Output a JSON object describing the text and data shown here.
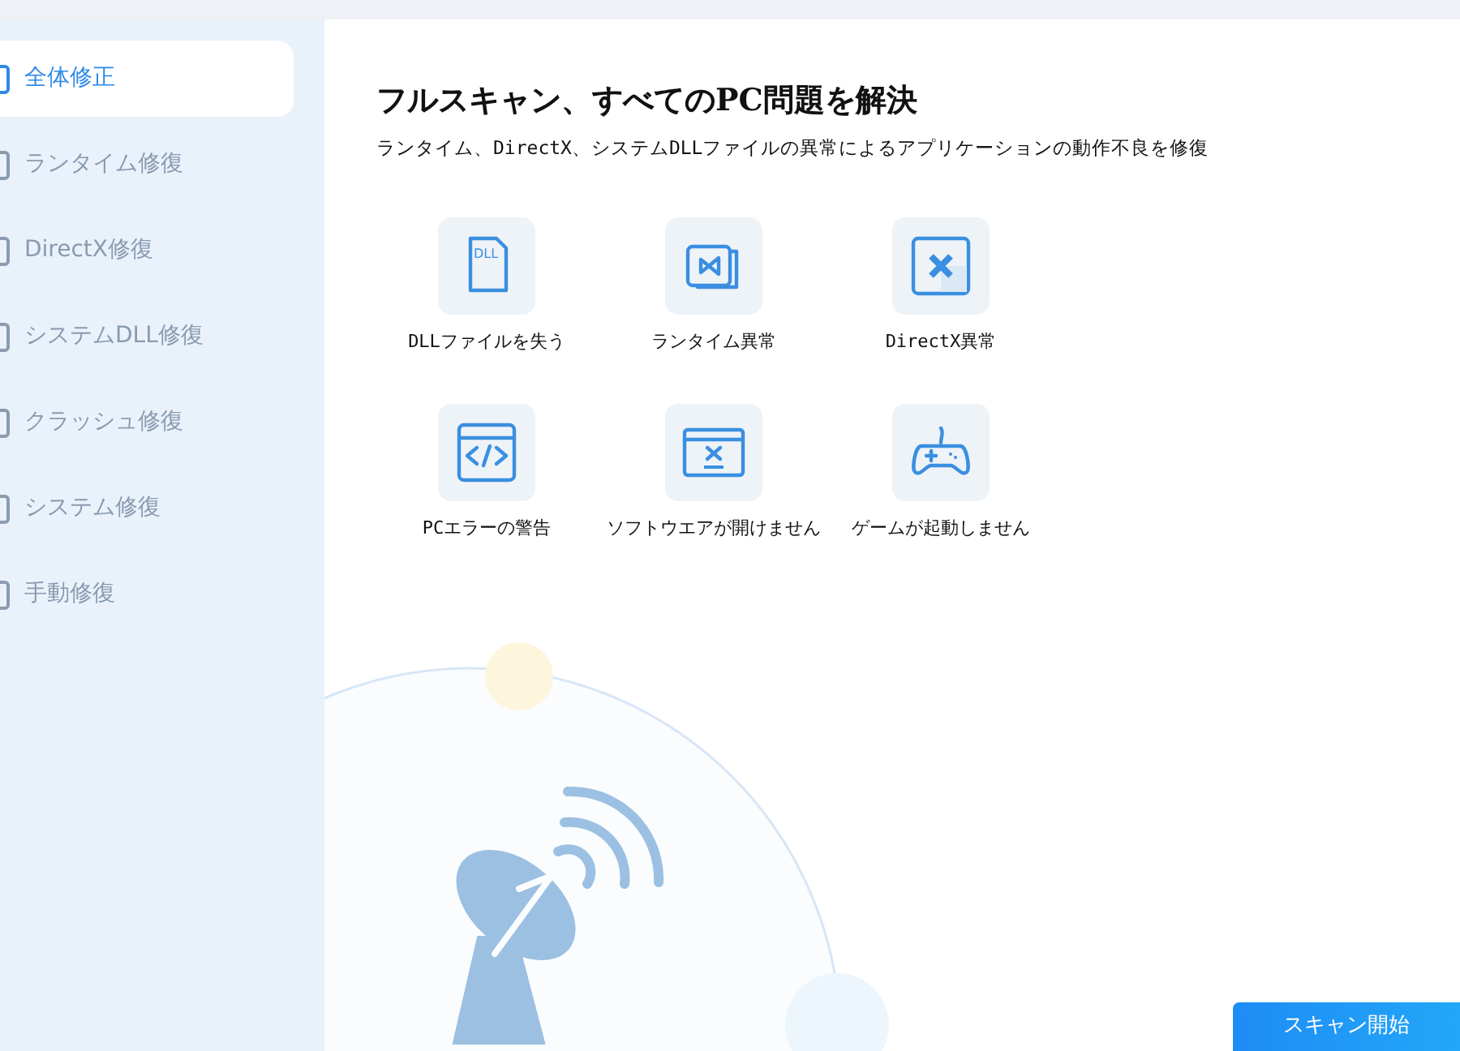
{
  "sidebar": {
    "items": [
      {
        "label": "全体修正",
        "selected": true
      },
      {
        "label": "ランタイム修復",
        "selected": false
      },
      {
        "label": "DirectX修復",
        "selected": false
      },
      {
        "label": "システムDLL修復",
        "selected": false
      },
      {
        "label": "クラッシュ修復",
        "selected": false
      },
      {
        "label": "システム修復",
        "selected": false
      },
      {
        "label": "手動修復",
        "selected": false
      }
    ]
  },
  "main": {
    "title": "フルスキャン、すべてのPC問題を解決",
    "subtitle": "ランタイム、DirectX、システムDLLファイルの異常によるアプリケーションの動作不良を修復",
    "issues": [
      {
        "kind": "dll",
        "icon_text": "DLL",
        "label": "DLLファイルを失う"
      },
      {
        "kind": "runtime",
        "label": "ランタイム異常"
      },
      {
        "kind": "directx",
        "label": "DirectX異常"
      },
      {
        "kind": "code",
        "label": "PCエラーの警告"
      },
      {
        "kind": "error",
        "label": "ソフトウエアが開けません"
      },
      {
        "kind": "game",
        "label": "ゲームが起動しません"
      }
    ]
  },
  "scan_button": {
    "label": "スキャン開始"
  }
}
